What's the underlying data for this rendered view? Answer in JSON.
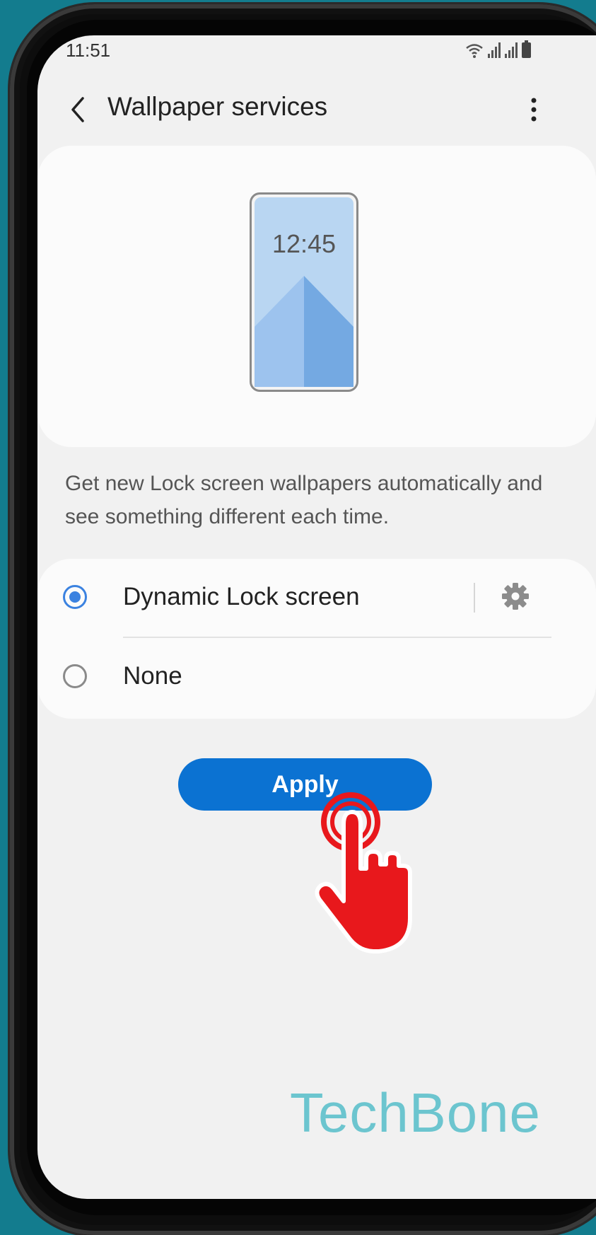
{
  "status_bar": {
    "time": "11:51"
  },
  "app_bar": {
    "title": "Wallpaper services",
    "back_icon": "chevron-left-icon",
    "more_icon": "more-vertical-icon"
  },
  "preview": {
    "clock": "12:45",
    "colors": {
      "screen_bg": "#b9d6f2",
      "mountain_left": "#9dc3ee",
      "mountain_right": "#74a9e2"
    }
  },
  "description": "Get new Lock screen wallpapers automatically and see something different each time.",
  "options": [
    {
      "label": "Dynamic Lock screen",
      "selected": true,
      "icon": "gear-icon"
    },
    {
      "label": "None",
      "selected": false
    }
  ],
  "apply_button": {
    "label": "Apply"
  },
  "overlay": {
    "tap_icon": "tap-hand-icon",
    "watermark": "TechBone"
  },
  "colors": {
    "accent": "#0b72d2",
    "radio_accent": "#3b82e0",
    "tap_red": "#e8181c",
    "watermark": "#6cc5cf",
    "background": "#137c8e"
  }
}
